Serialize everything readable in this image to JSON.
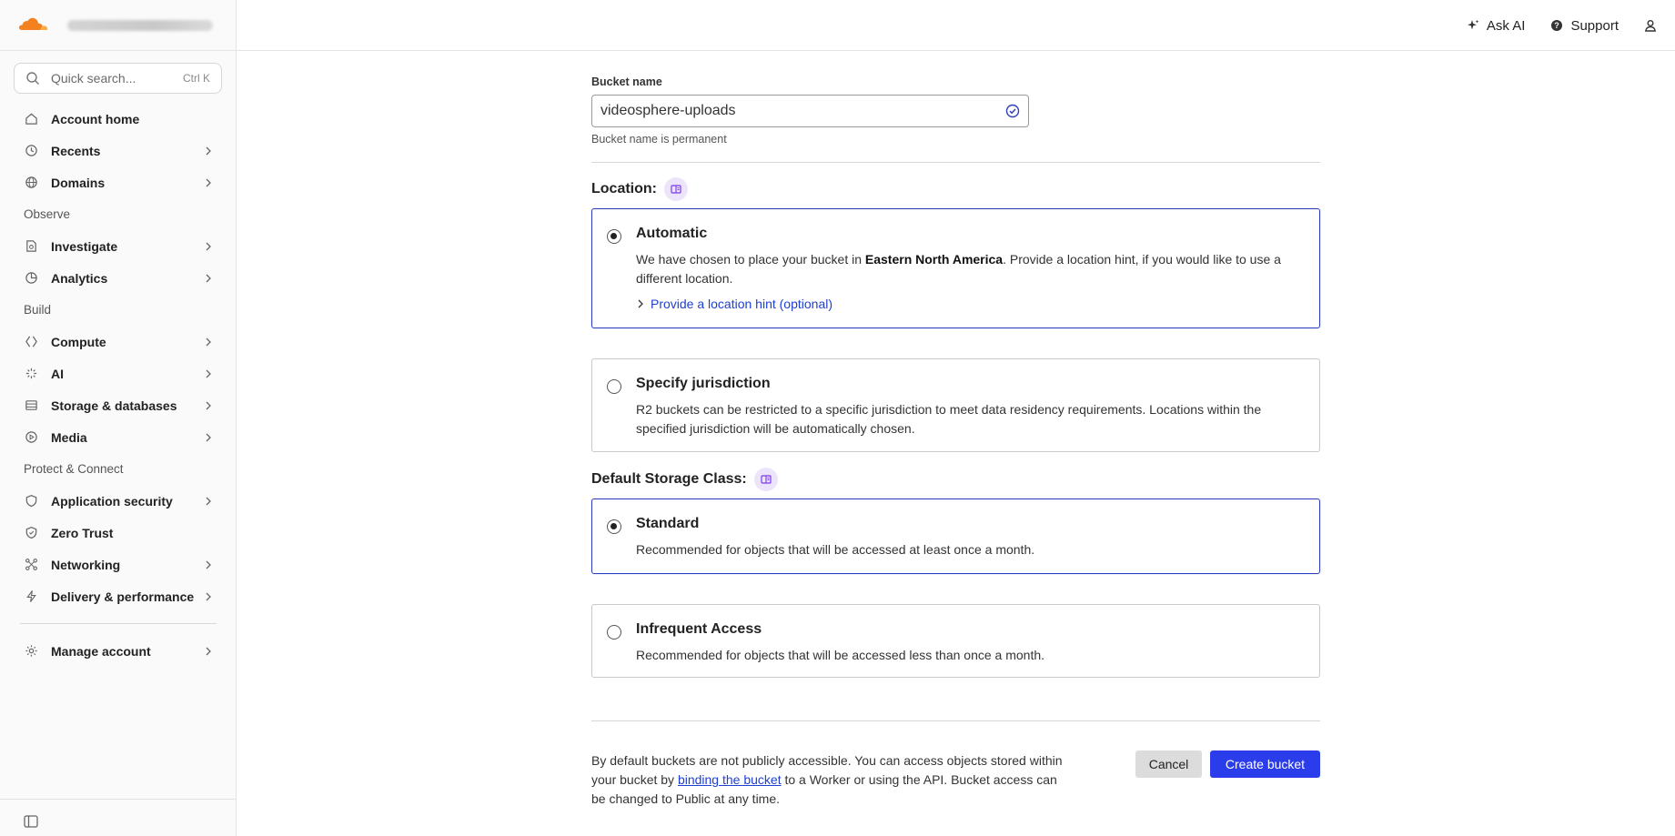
{
  "colors": {
    "accent": "#2b3dea",
    "link": "#1f3fd1",
    "brand_orange": "#f48120",
    "selected_border": "#2d3fbf",
    "info_bg": "#ece4fb",
    "info_icon": "#7c3aed"
  },
  "sidebar": {
    "search": {
      "placeholder": "Quick search...",
      "shortcut": "Ctrl K"
    },
    "items_top": [
      {
        "label": "Account home",
        "icon": "home-icon"
      },
      {
        "label": "Recents",
        "icon": "clock-icon"
      },
      {
        "label": "Domains",
        "icon": "globe-icon"
      }
    ],
    "observe": {
      "heading": "Observe",
      "items": [
        {
          "label": "Investigate"
        },
        {
          "label": "Analytics"
        }
      ]
    },
    "build": {
      "heading": "Build",
      "items": [
        {
          "label": "Compute"
        },
        {
          "label": "AI"
        },
        {
          "label": "Storage & databases"
        },
        {
          "label": "Media"
        }
      ]
    },
    "protect": {
      "heading": "Protect & Connect",
      "items": [
        {
          "label": "Application security"
        },
        {
          "label": "Zero Trust"
        },
        {
          "label": "Networking"
        },
        {
          "label": "Delivery & performance"
        }
      ]
    },
    "bottom": {
      "label": "Manage account"
    }
  },
  "topbar": {
    "ask_ai": "Ask AI",
    "support": "Support"
  },
  "form": {
    "bucket_name_label": "Bucket name",
    "bucket_name_value": "videosphere-uploads",
    "bucket_name_hint": "Bucket name is permanent",
    "location": {
      "title": "Location:",
      "automatic": {
        "title": "Automatic",
        "desc_before": "We have chosen to place your bucket in ",
        "desc_bold": "Eastern North America",
        "desc_after": ". Provide a location hint, if you would like to use a different location.",
        "link": "Provide a location hint (optional)",
        "selected": true
      },
      "jurisdiction": {
        "title": "Specify jurisdiction",
        "desc": "R2 buckets can be restricted to a specific jurisdiction to meet data residency requirements. Locations within the specified jurisdiction will be automatically chosen.",
        "selected": false
      }
    },
    "storage_class": {
      "title": "Default Storage Class:",
      "standard": {
        "title": "Standard",
        "desc": "Recommended for objects that will be accessed at least once a month.",
        "selected": true
      },
      "infrequent": {
        "title": "Infrequent Access",
        "desc": "Recommended for objects that will be accessed less than once a month.",
        "selected": false
      }
    },
    "footer": {
      "text_before": "By default buckets are not publicly accessible. You can access objects stored within your bucket by ",
      "link": "binding the bucket",
      "text_after": " to a Worker or using the API. Bucket access can be changed to Public at any time."
    },
    "cancel": "Cancel",
    "create": "Create bucket"
  }
}
